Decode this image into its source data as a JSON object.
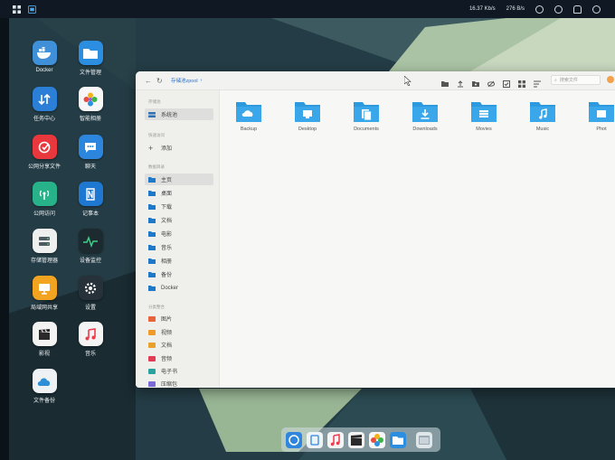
{
  "topbar": {
    "network_down": "16.37 Kb/s",
    "network_up": "276 B/s",
    "icons": [
      "grid-icon",
      "app-window-icon",
      "download-arrow-icon",
      "upload-arrow-icon",
      "clock-icon",
      "settings-icon",
      "bell-icon",
      "user-icon"
    ]
  },
  "desktop_icons": [
    {
      "name": "docker",
      "label": "Docker",
      "icon": "docker-whale-icon"
    },
    {
      "name": "file-manager",
      "label": "文件管理",
      "icon": "folder-icon"
    },
    {
      "name": "task-center",
      "label": "任务中心",
      "icon": "task-arrows-icon"
    },
    {
      "name": "smart-album",
      "label": "智能相册",
      "icon": "photo-flower-icon"
    },
    {
      "name": "public-share",
      "label": "公网分享文件",
      "icon": "share-link-icon"
    },
    {
      "name": "chat",
      "label": "聊天",
      "icon": "chat-bubble-icon"
    },
    {
      "name": "public-access",
      "label": "公网访问",
      "icon": "antenna-icon"
    },
    {
      "name": "notes",
      "label": "记事本",
      "icon": "notebook-icon"
    },
    {
      "name": "storage-manager",
      "label": "存储管理器",
      "icon": "storage-drive-icon"
    },
    {
      "name": "device-monitor",
      "label": "设备监控",
      "icon": "pulse-monitor-icon"
    },
    {
      "name": "lan-share",
      "label": "局域网共享",
      "icon": "lan-monitor-icon"
    },
    {
      "name": "settings",
      "label": "设置",
      "icon": "gear-icon"
    },
    {
      "name": "video",
      "label": "影视",
      "icon": "clapperboard-icon"
    },
    {
      "name": "music",
      "label": "音乐",
      "icon": "music-note-icon"
    },
    {
      "name": "file-backup",
      "label": "文件备份",
      "icon": "cloud-backup-icon"
    }
  ],
  "window": {
    "breadcrumb": [
      "存储池zpool",
      "›"
    ],
    "search_placeholder": "搜索文件",
    "sidebar": {
      "section_storage": "存储池",
      "storage_item": "系统池",
      "section_quick": "快速访问",
      "add_label": "添加",
      "section_folders": "数据目录",
      "folders": [
        "主页",
        "桌面",
        "下载",
        "文档",
        "电影",
        "音乐",
        "相册",
        "备份",
        "Docker"
      ],
      "section_categories": "分类整合",
      "categories": [
        "图片",
        "视频",
        "文档",
        "音频",
        "电子书",
        "压缩包"
      ]
    },
    "folders": [
      {
        "name": "Backup",
        "icon": "cloud-upload-icon"
      },
      {
        "name": "Desktop",
        "icon": "monitor-icon"
      },
      {
        "name": "Documents",
        "icon": "documents-icon"
      },
      {
        "name": "Downloads",
        "icon": "download-icon"
      },
      {
        "name": "Movies",
        "icon": "film-icon"
      },
      {
        "name": "Music",
        "icon": "music-note-icon"
      },
      {
        "name": "Phot",
        "icon": "photo-icon"
      }
    ]
  },
  "dock": {
    "items": [
      "app-store-icon",
      "task-icon",
      "music-icon",
      "video-icon",
      "photos-icon",
      "file-manager-icon",
      "window-switcher-icon"
    ]
  },
  "colors": {
    "accent": "#2f8fd6",
    "folder": "#2d9ae0",
    "wallpaper_teal": "#2f4c53",
    "wallpaper_green": "#9db899"
  }
}
